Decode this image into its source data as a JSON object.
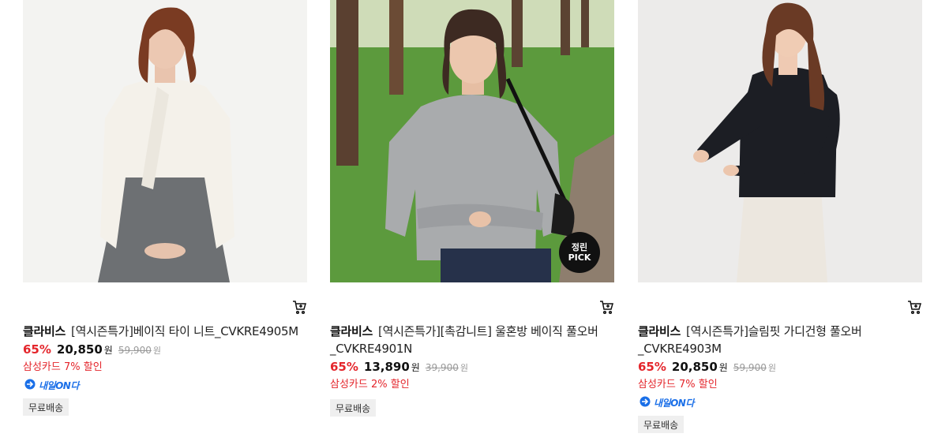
{
  "products": [
    {
      "brand": "클라비스",
      "name": "[역시즌특가]베이직 타이 니트_CVKRE4905M",
      "discount": "65%",
      "price": "20,850",
      "price_unit": "원",
      "original_price": "59,900",
      "original_unit": "원",
      "card_discount": "삼성카드 7% 할인",
      "delivery": "내일ON다",
      "shipping": "무료배송",
      "badge": null
    },
    {
      "brand": "클라비스",
      "name": "[역시즌특가][촉감니트] 울혼방 베이직 풀오버 _CVKRE4901N",
      "discount": "65%",
      "price": "13,890",
      "price_unit": "원",
      "original_price": "39,900",
      "original_unit": "원",
      "card_discount": "삼성카드 2% 할인",
      "delivery": null,
      "shipping": "무료배송",
      "badge": {
        "line1": "정린",
        "line2": "PICK"
      }
    },
    {
      "brand": "클라비스",
      "name": "[역시즌특가]슬림핏 가디건형 풀오버 _CVKRE4903M",
      "discount": "65%",
      "price": "20,850",
      "price_unit": "원",
      "original_price": "59,900",
      "original_unit": "원",
      "card_discount": "삼성카드 7% 할인",
      "delivery": "내일ON다",
      "shipping": "무료배송",
      "badge": null
    }
  ],
  "colors": {
    "discount": "#e4262c",
    "delivery": "#1a6fe8",
    "badge_bg": "#efefef"
  }
}
